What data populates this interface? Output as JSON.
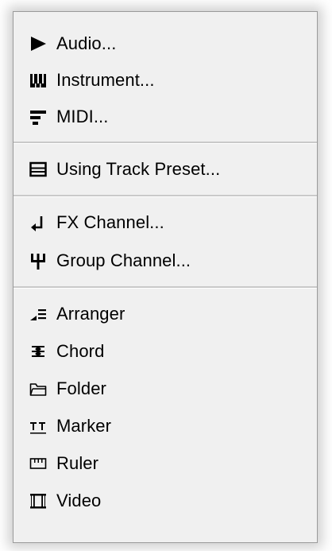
{
  "menu": {
    "groups": [
      {
        "items": [
          {
            "label": "Audio...",
            "icon": "audio-play-icon"
          },
          {
            "label": "Instrument...",
            "icon": "instrument-keys-icon"
          },
          {
            "label": "MIDI...",
            "icon": "midi-icon"
          }
        ]
      },
      {
        "items": [
          {
            "label": "Using Track Preset...",
            "icon": "track-preset-icon"
          }
        ]
      },
      {
        "items": [
          {
            "label": "FX Channel...",
            "icon": "fx-channel-icon"
          },
          {
            "label": "Group Channel...",
            "icon": "group-channel-icon"
          }
        ]
      },
      {
        "items": [
          {
            "label": "Arranger",
            "icon": "arranger-icon"
          },
          {
            "label": "Chord",
            "icon": "chord-icon"
          },
          {
            "label": "Folder",
            "icon": "folder-icon"
          },
          {
            "label": "Marker",
            "icon": "marker-icon"
          },
          {
            "label": "Ruler",
            "icon": "ruler-icon"
          },
          {
            "label": "Video",
            "icon": "video-icon"
          }
        ]
      }
    ]
  },
  "colors": {
    "menu_background": "#f0f0f0",
    "separator": "#c9c9c9",
    "text": "#000000"
  }
}
